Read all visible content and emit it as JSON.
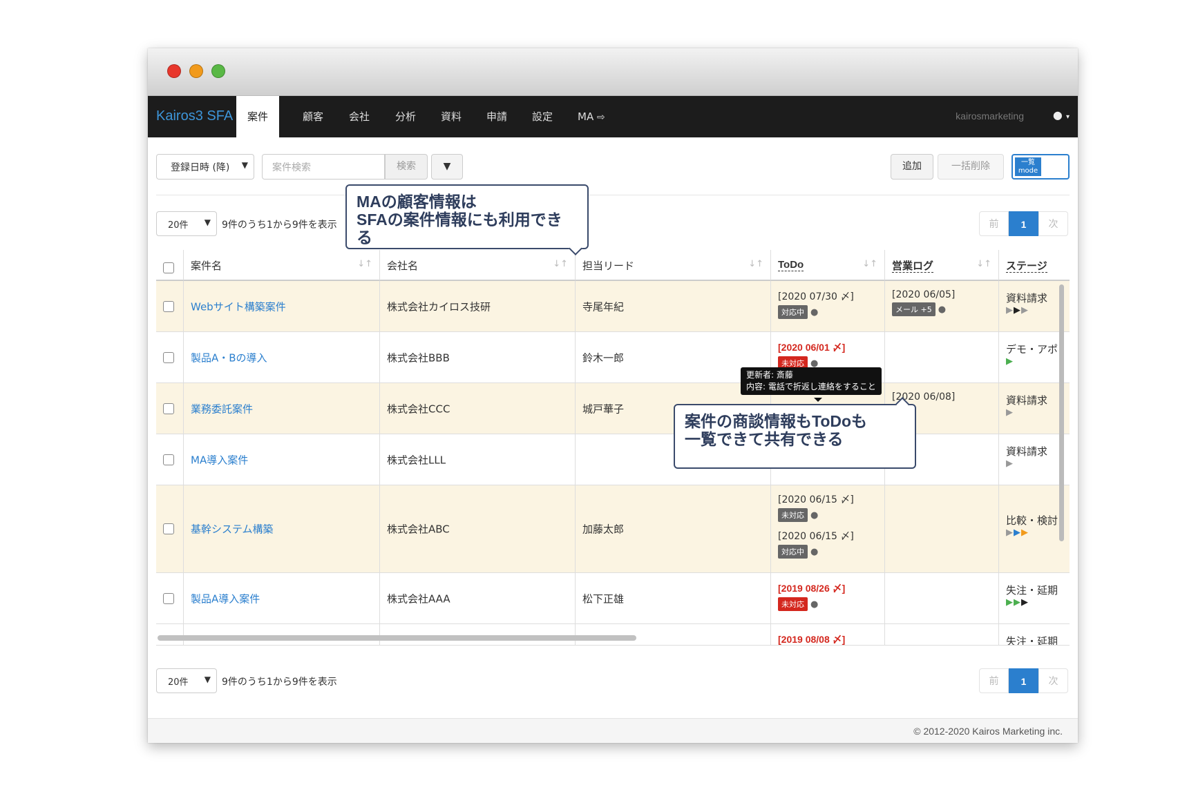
{
  "app": {
    "brand": "Kairos3 SFA",
    "nav": [
      "案件",
      "顧客",
      "会社",
      "分析",
      "資料",
      "申請",
      "設定",
      "MA"
    ],
    "nav_active": "案件",
    "user": "kairosmarketing",
    "user_icon": "person-icon",
    "ma_icon": "external-link-icon"
  },
  "toolbar": {
    "sort_select": "登録日時 (降)",
    "search_placeholder": "案件検索",
    "search_button": "検索",
    "filter_icon": "filter-icon",
    "add_button": "追加",
    "bulk_delete_button": "一括削除",
    "mode_label_top": "一覧",
    "mode_label_bottom": "mode"
  },
  "paging": {
    "page_size": "20件",
    "info": "9件のうち1から9件を表示",
    "prev": "前",
    "current": "1",
    "next": "次"
  },
  "table": {
    "headers": {
      "deal": "案件名",
      "company": "会社名",
      "lead": "担当リード",
      "todo": "ToDo",
      "log": "営業ログ",
      "stage": "ステージ"
    },
    "rows": [
      {
        "deal": "Webサイト構築案件",
        "company": "株式会社カイロス技研",
        "lead": "寺尾年紀",
        "todo1_date": "[2020 07/30 〆]",
        "todo1_badge": "対応中",
        "log_date": "[2020 06/05]",
        "log_badge": "メール +5",
        "stage": "資料請求"
      },
      {
        "deal": "製品A・Bの導入",
        "company": "株式会社BBB",
        "lead": "鈴木一郎",
        "todo1_date": "[2020 06/01 〆]",
        "todo1_badge": "未対応",
        "stage": "デモ・アポ"
      },
      {
        "deal": "業務委託案件",
        "company": "株式会社CCC",
        "lead": "城戸華子",
        "log_date": "[2020 06/08]",
        "log_badge": "0",
        "stage": "資料請求"
      },
      {
        "deal": "MA導入案件",
        "company": "株式会社LLL",
        "lead": "",
        "stage": "資料請求"
      },
      {
        "deal": "基幹システム構築",
        "company": "株式会社ABC",
        "lead": "加藤太郎",
        "todo1_date": "[2020 06/15 〆]",
        "todo1_badge": "未対応",
        "todo2_date": "[2020 06/15 〆]",
        "todo2_badge": "対応中",
        "stage": "比較・検討"
      },
      {
        "deal": "製品A導入案件",
        "company": "株式会社AAA",
        "lead": "松下正雄",
        "todo1_date": "[2019 08/26 〆]",
        "todo1_badge": "未対応",
        "stage": "失注・延期"
      },
      {
        "todo1_date": "[2019 08/08 〆]",
        "stage": "失注・延期"
      }
    ]
  },
  "tooltip": {
    "line1": "更新者: 斎藤",
    "line2": "内容: 電話で折返し連絡をすること"
  },
  "callouts": {
    "ma": {
      "line1": "MAの顧客情報は",
      "line2": "SFAの案件情報にも利用できる"
    },
    "todo": {
      "line1": "案件の商談情報もToDoも",
      "line2": "一覧できて共有できる"
    }
  },
  "footer": "© 2012-2020 Kairos Marketing inc.",
  "colors": {
    "accent": "#2b7fce",
    "navbar": "#1c1c1c",
    "highlight_row": "#fbf4e2",
    "overdue": "#d4271e"
  }
}
